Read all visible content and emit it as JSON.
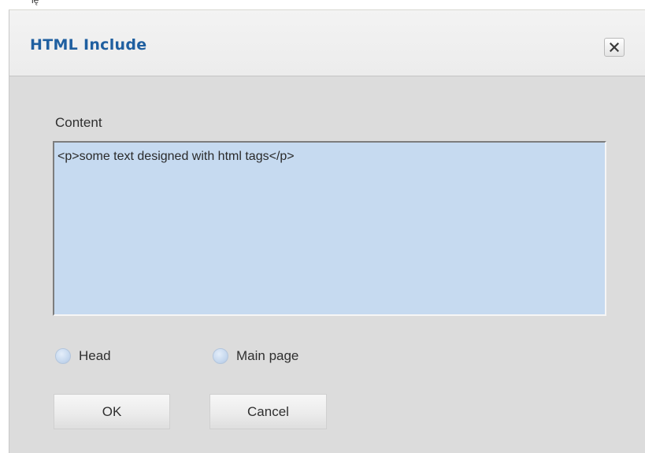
{
  "window": {
    "title": "HTML Include",
    "top_glyph": "ię"
  },
  "form": {
    "content_label": "Content",
    "content_value": "<p>some text designed with html tags</p>",
    "radio_head_label": "Head",
    "radio_main_label": "Main page",
    "ok_label": "OK",
    "cancel_label": "Cancel"
  },
  "icons": {
    "close": "close-icon"
  },
  "colors": {
    "title": "#1f5fa0",
    "dialog_bg": "#dcdcdc",
    "textarea_bg": "#c6daf0",
    "radio": "#c6d8ee"
  }
}
